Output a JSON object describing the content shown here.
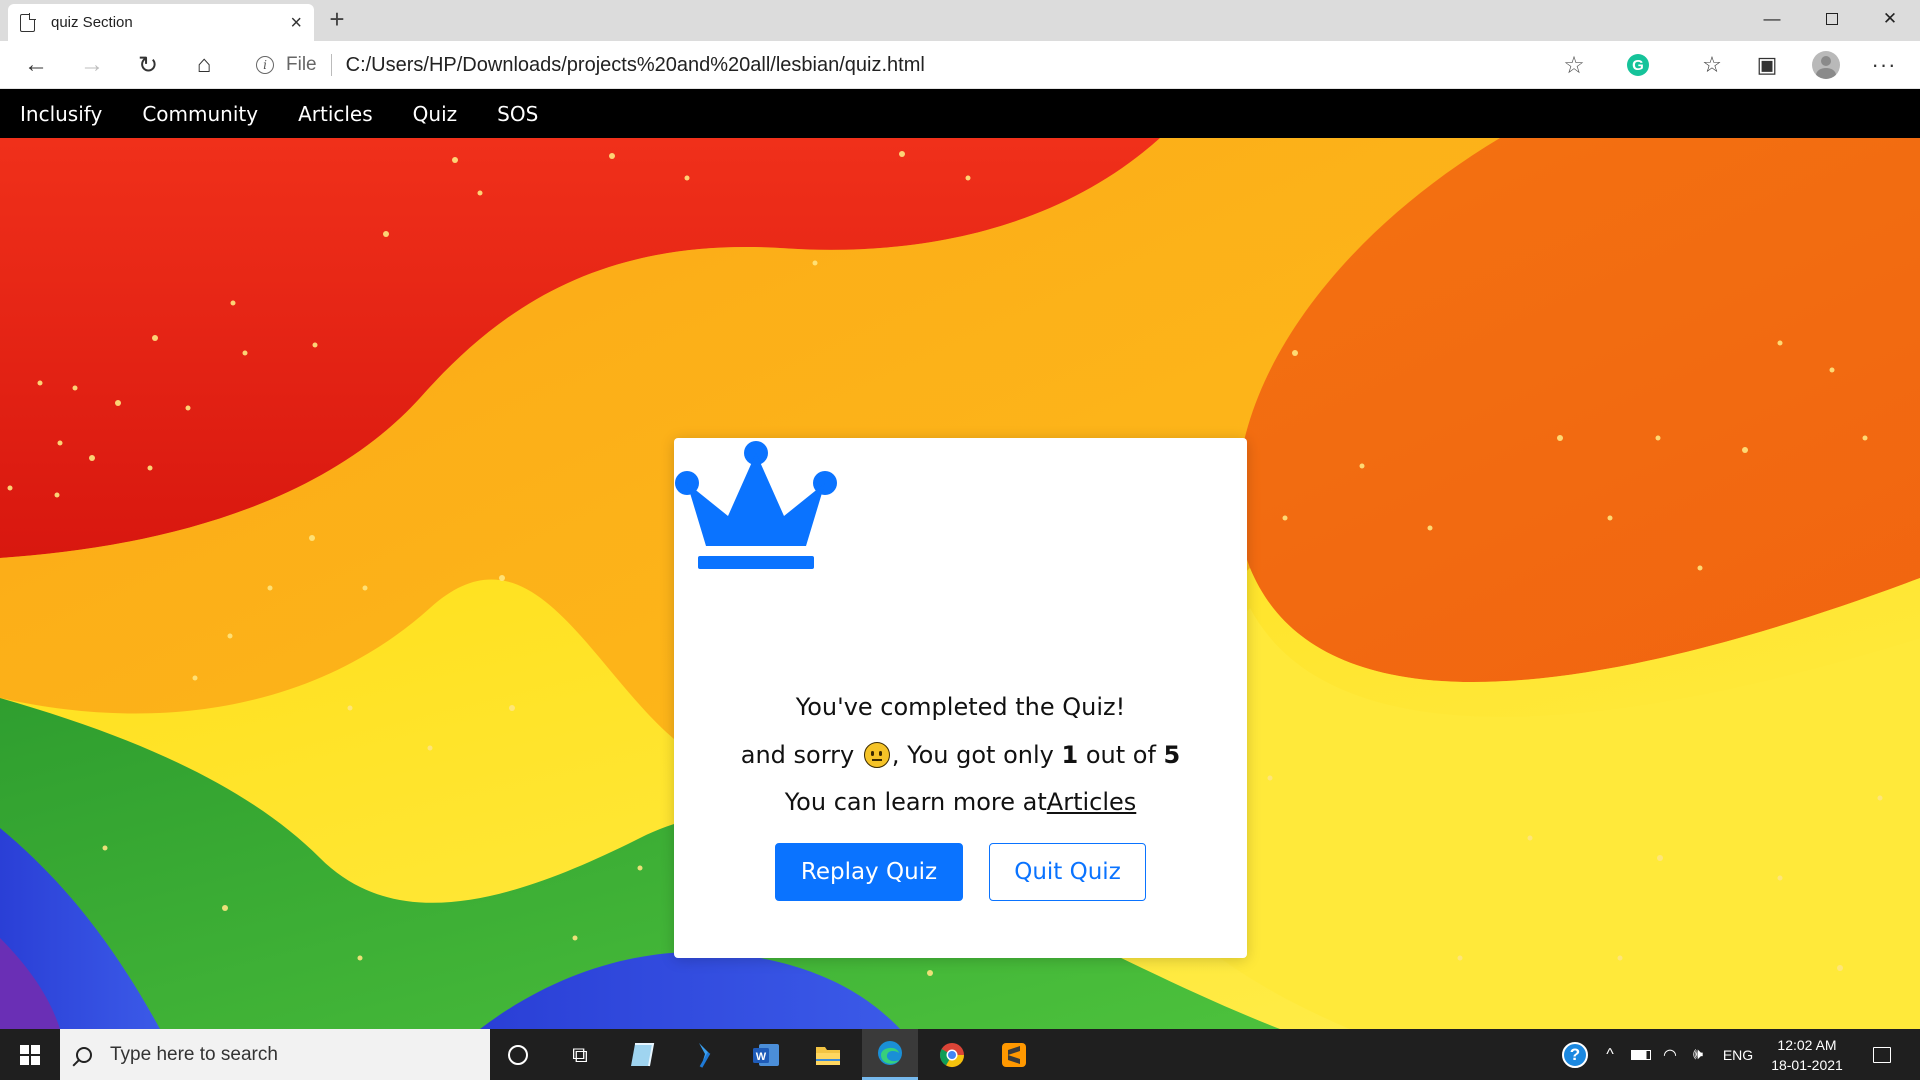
{
  "browser": {
    "tab_title": "quiz Section",
    "tab_close": "×",
    "new_tab": "+",
    "address_scheme": "File",
    "address_url": "C:/Users/HP/Downloads/projects%20and%20all/lesbian/quiz.html",
    "window_min": "—",
    "window_close": "✕",
    "back": "←",
    "forward": "→",
    "reload": "↻",
    "home": "⌂",
    "star": "☆",
    "grammarly": "G",
    "favorites": "☆",
    "collections": "▣",
    "more": "···"
  },
  "sitenav": {
    "items": [
      "Inclusify",
      "Community",
      "Articles",
      "Quiz",
      "SOS"
    ]
  },
  "result": {
    "title": "You've completed the Quiz!",
    "score_prefix": "and sorry",
    "score_mid": ", You got only",
    "score_value": "1",
    "score_out_of": "out of",
    "score_total": "5",
    "learn_text": "You can learn more at",
    "learn_link": "Articles",
    "replay_label": "Replay Quiz",
    "quit_label": "Quit Quiz",
    "accent_color": "#0a73ff"
  },
  "taskbar": {
    "search_placeholder": "Type here to search",
    "taskview": "⧉",
    "help": "?",
    "tray_up": "^",
    "wifi": "◠",
    "volume": "🕪",
    "language": "ENG",
    "time": "12:02 AM",
    "date": "18-01-2021"
  }
}
